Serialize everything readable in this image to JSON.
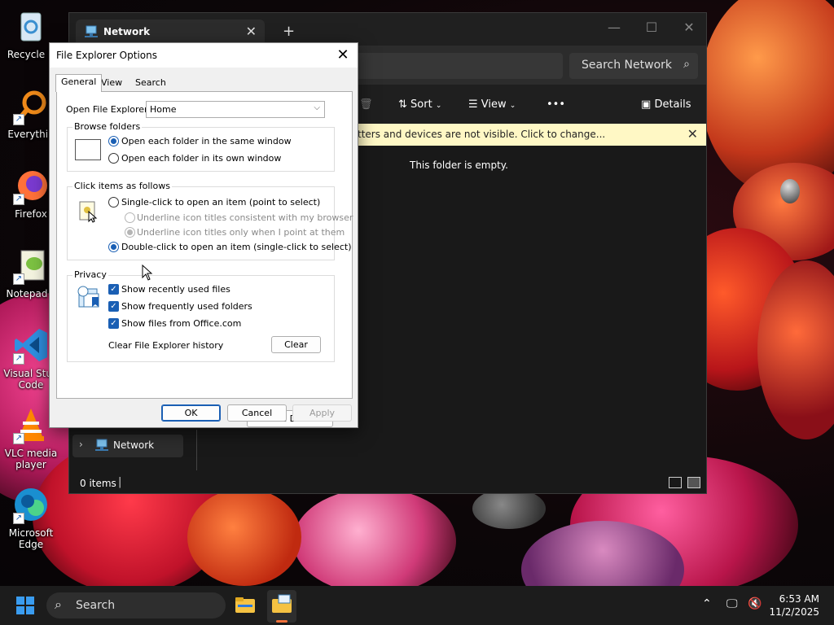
{
  "desktop": {
    "icons": [
      {
        "label": "Recycle B",
        "icon": "recycle-bin-icon"
      },
      {
        "label": "Everythin",
        "icon": "everything-search-icon"
      },
      {
        "label": "Firefox",
        "icon": "firefox-icon"
      },
      {
        "label": "Notepad+",
        "icon": "notepad-plus-icon"
      },
      {
        "label": "Visual Stud Code",
        "icon": "vscode-icon"
      },
      {
        "label": "VLC media player",
        "icon": "vlc-icon"
      },
      {
        "label": "Microsoft Edge",
        "icon": "edge-icon"
      }
    ]
  },
  "explorer": {
    "tab_title": "Network",
    "search_placeholder": "Search Network",
    "commands": {
      "sort": "Sort",
      "view": "View",
      "more": "•••",
      "details": "Details"
    },
    "info_bar": "tters and devices are not visible. Click to change...",
    "empty_message": "This folder is empty.",
    "nav_item": "Network",
    "status_items": "0 items"
  },
  "dialog": {
    "title": "File Explorer Options",
    "tabs": [
      "General",
      "View",
      "Search"
    ],
    "active_tab": "General",
    "open_label": "Open File Explorer to:",
    "open_value": "Home",
    "browse": {
      "title": "Browse folders",
      "options": [
        "Open each folder in the same window",
        "Open each folder in its own window"
      ],
      "selected": 0
    },
    "click": {
      "title": "Click items as follows",
      "single": "Single-click to open an item (point to select)",
      "sub1": "Underline icon titles consistent with my browser",
      "sub2": "Underline icon titles only when I point at them",
      "double": "Double-click to open an item (single-click to select)",
      "selected": "double"
    },
    "privacy": {
      "title": "Privacy",
      "checks": [
        "Show recently used files",
        "Show frequently used folders",
        "Show files from Office.com"
      ],
      "clear_label": "Clear File Explorer history",
      "clear_button": "Clear"
    },
    "restore_button": "Restore Defaults",
    "ok": "OK",
    "cancel": "Cancel",
    "apply": "Apply"
  },
  "taskbar": {
    "search": "Search",
    "time": "6:53 AM",
    "date": "11/2/2025"
  },
  "colors": {
    "accent": "#1a5fb4",
    "info_bar": "#fff8c5"
  }
}
